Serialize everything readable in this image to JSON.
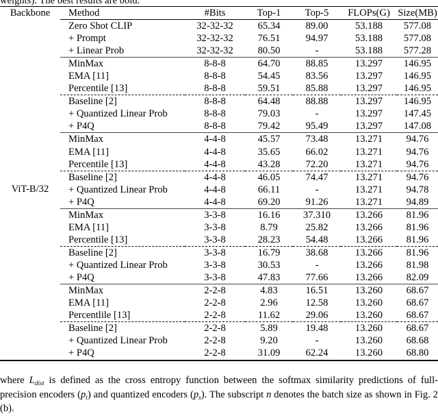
{
  "caption_clipped": "weights). The best results are bold.",
  "table": {
    "headers": {
      "backbone": "Backbone",
      "method": "Method",
      "bits": "#Bits",
      "top1": "Top-1",
      "top5": "Top-5",
      "flops": "FLOPs(G)",
      "size": "Size(MB)"
    },
    "backbone_label": "ViT-B/32",
    "groups": [
      {
        "rows": [
          {
            "method": "Zero Shot CLIP",
            "bits": "32-32-32",
            "top1": "65.34",
            "top5": "89.00",
            "flops": "53.188",
            "size": "577.08",
            "bold": false,
            "dashed_above": false
          },
          {
            "method": "+ Prompt",
            "bits": "32-32-32",
            "top1": "76.51",
            "top5": "94.97",
            "flops": "53.188",
            "size": "577.08",
            "bold": false,
            "dashed_above": false
          },
          {
            "method": "+ Linear Prob",
            "bits": "32-32-32",
            "top1": "80.50",
            "top5": "-",
            "flops": "53.188",
            "size": "577.28",
            "bold": false,
            "dashed_above": false
          }
        ]
      },
      {
        "rows": [
          {
            "method": "MinMax",
            "bits": "8-8-8",
            "top1": "64.70",
            "top5": "88.85",
            "flops": "13.297",
            "size": "146.95",
            "bold": false,
            "dashed_above": false
          },
          {
            "method": "EMA [11]",
            "bits": "8-8-8",
            "top1": "54.45",
            "top5": "83.56",
            "flops": "13.297",
            "size": "146.95",
            "bold": false,
            "dashed_above": false
          },
          {
            "method": "Percentile [13]",
            "bits": "8-8-8",
            "top1": "59.51",
            "top5": "85.88",
            "flops": "13.297",
            "size": "146.95",
            "bold": false,
            "dashed_above": false
          },
          {
            "method": "Baseline [2]",
            "bits": "8-8-8",
            "top1": "64.48",
            "top5": "88.88",
            "flops": "13.297",
            "size": "146.95",
            "bold": false,
            "dashed_above": true
          },
          {
            "method": "+ Quantized Linear Prob",
            "bits": "8-8-8",
            "top1": "79.03",
            "top5": "-",
            "flops": "13.297",
            "size": "147.45",
            "bold": false,
            "dashed_above": false
          },
          {
            "method": "+ P4Q",
            "bits": "8-8-8",
            "top1": "79.42",
            "top5": "95.49",
            "flops": "13.297",
            "size": "147.08",
            "bold": true,
            "dashed_above": false
          }
        ]
      },
      {
        "rows": [
          {
            "method": "MinMax",
            "bits": "4-4-8",
            "top1": "45.57",
            "top5": "73.48",
            "flops": "13.271",
            "size": "94.76",
            "bold": false,
            "dashed_above": false
          },
          {
            "method": "EMA [11]",
            "bits": "4-4-8",
            "top1": "35.65",
            "top5": "66.02",
            "flops": "13.271",
            "size": "94.76",
            "bold": false,
            "dashed_above": false
          },
          {
            "method": "Percentile [13]",
            "bits": "4-4-8",
            "top1": "43.28",
            "top5": "72.20",
            "flops": "13.271",
            "size": "94.76",
            "bold": false,
            "dashed_above": false
          },
          {
            "method": "Baseline [2]",
            "bits": "4-4-8",
            "top1": "46.05",
            "top5": "74.47",
            "flops": "13.271",
            "size": "94.76",
            "bold": false,
            "dashed_above": true
          },
          {
            "method": "+ Quantized Linear Prob",
            "bits": "4-4-8",
            "top1": "66.11",
            "top5": "-",
            "flops": "13.271",
            "size": "94.78",
            "bold": false,
            "dashed_above": false
          },
          {
            "method": "+ P4Q",
            "bits": "4-4-8",
            "top1": "69.20",
            "top5": "91.26",
            "flops": "13.271",
            "size": "94.89",
            "bold": true,
            "dashed_above": false
          }
        ]
      },
      {
        "rows": [
          {
            "method": "MinMax",
            "bits": "3-3-8",
            "top1": "16.16",
            "top5": "37.310",
            "flops": "13.266",
            "size": "81.96",
            "bold": false,
            "dashed_above": false
          },
          {
            "method": "EMA [11]",
            "bits": "3-3-8",
            "top1": "8.79",
            "top5": "25.82",
            "flops": "13.266",
            "size": "81.96",
            "bold": false,
            "dashed_above": false
          },
          {
            "method": "Percentile [13]",
            "bits": "3-3-8",
            "top1": "28.23",
            "top5": "54.48",
            "flops": "13.266",
            "size": "81.96",
            "bold": false,
            "dashed_above": false
          },
          {
            "method": "Baseline [2]",
            "bits": "3-3-8",
            "top1": "16.79",
            "top5": "38.68",
            "flops": "13.266",
            "size": "81.96",
            "bold": false,
            "dashed_above": true
          },
          {
            "method": "+ Quantized Linear Prob",
            "bits": "3-3-8",
            "top1": "30.53",
            "top5": "-",
            "flops": "13.266",
            "size": "81.98",
            "bold": false,
            "dashed_above": false
          },
          {
            "method": "+ P4Q",
            "bits": "3-3-8",
            "top1": "47.83",
            "top5": "77.66",
            "flops": "13.266",
            "size": "82.09",
            "bold": true,
            "dashed_above": false
          }
        ]
      },
      {
        "rows": [
          {
            "method": "MinMax",
            "bits": "2-2-8",
            "top1": "4.83",
            "top5": "16.51",
            "flops": "13.260",
            "size": "68.67",
            "bold": false,
            "dashed_above": false
          },
          {
            "method": "EMA [11]",
            "bits": "2-2-8",
            "top1": "2.96",
            "top5": "12.58",
            "flops": "13.260",
            "size": "68.67",
            "bold": false,
            "dashed_above": false
          },
          {
            "method": "Percentlile [13]",
            "bits": "2-2-8",
            "top1": "11.62",
            "top5": "29.06",
            "flops": "13.260",
            "size": "68.67",
            "bold": false,
            "dashed_above": false
          },
          {
            "method": "Baseline [2]",
            "bits": "2-2-8",
            "top1": "5.89",
            "top5": "19.48",
            "flops": "13.260",
            "size": "68.67",
            "bold": false,
            "dashed_above": true
          },
          {
            "method": "+ Quantized Linear Prob",
            "bits": "2-2-8",
            "top1": "9.20",
            "top5": "-",
            "flops": "13.260",
            "size": "68.68",
            "bold": false,
            "dashed_above": false
          },
          {
            "method": "+ P4Q",
            "bits": "2-2-8",
            "top1": "31.09",
            "top5": "62.24",
            "flops": "13.260",
            "size": "68.80",
            "bold": true,
            "dashed_above": false
          }
        ]
      }
    ]
  },
  "paragraph": {
    "seg1": "where ",
    "math_l": "L",
    "math_l_sub": "dist",
    "seg2": " is defined as the cross entropy function between the softmax similarity predictions of full-precision encoders (",
    "math_pt": "p",
    "math_pt_sub": "t",
    "seg3": ") and quantized encoders (",
    "math_ps": "p",
    "math_ps_sub": "s",
    "seg4": "). The subscript ",
    "math_n": "n",
    "seg5": " denotes the batch size as shown in Fig. 2 (b)."
  }
}
